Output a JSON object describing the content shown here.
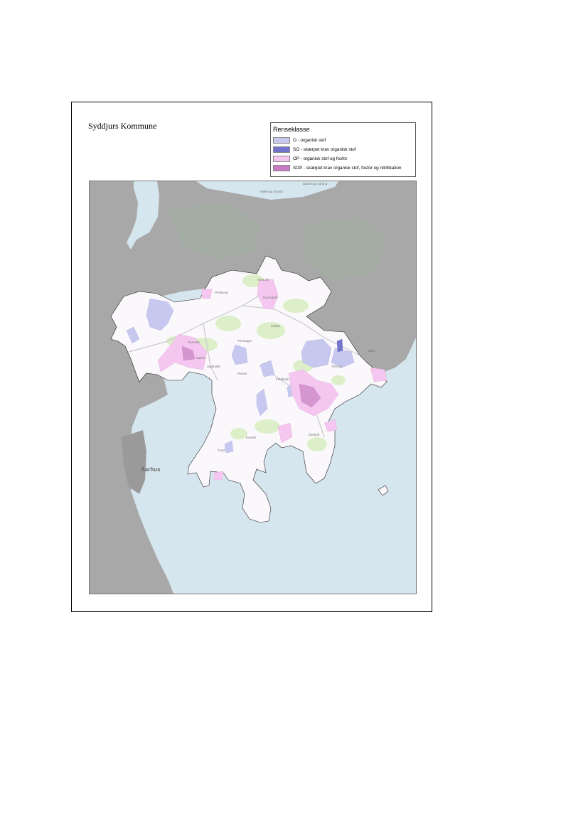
{
  "title": "Syddjurs Kommune",
  "legend": {
    "title": "Renseklasse",
    "items": [
      {
        "label": "O - organisk stof",
        "color": "#c7c8ef"
      },
      {
        "label": "SO - skærpet krav organisk stof",
        "color": "#7474cc"
      },
      {
        "label": "OP - organisk stof og fosfor",
        "color": "#f5c7f0"
      },
      {
        "label": "SOP - skærpet krav organisk stof, fosfor og nitrifikation",
        "color": "#c97ac4"
      }
    ]
  },
  "map": {
    "colors": {
      "sea": "#d6e6ef",
      "land": "#a8a8a8",
      "municipality": "#fbf8fb",
      "green": "#dcefc8"
    },
    "places": [
      "Fjellerup Strand",
      "Bønnerup Strand",
      "Pindstrup",
      "Hornslet",
      "Kolind",
      "Thorsager",
      "Rønde",
      "Ryomgård",
      "Mørke",
      "Nimtofte",
      "Tirstrup",
      "Ugelbølle",
      "Ebeltoft",
      "Knebel",
      "Tved",
      "Feldballe",
      "Balle",
      "Aarhus"
    ]
  }
}
